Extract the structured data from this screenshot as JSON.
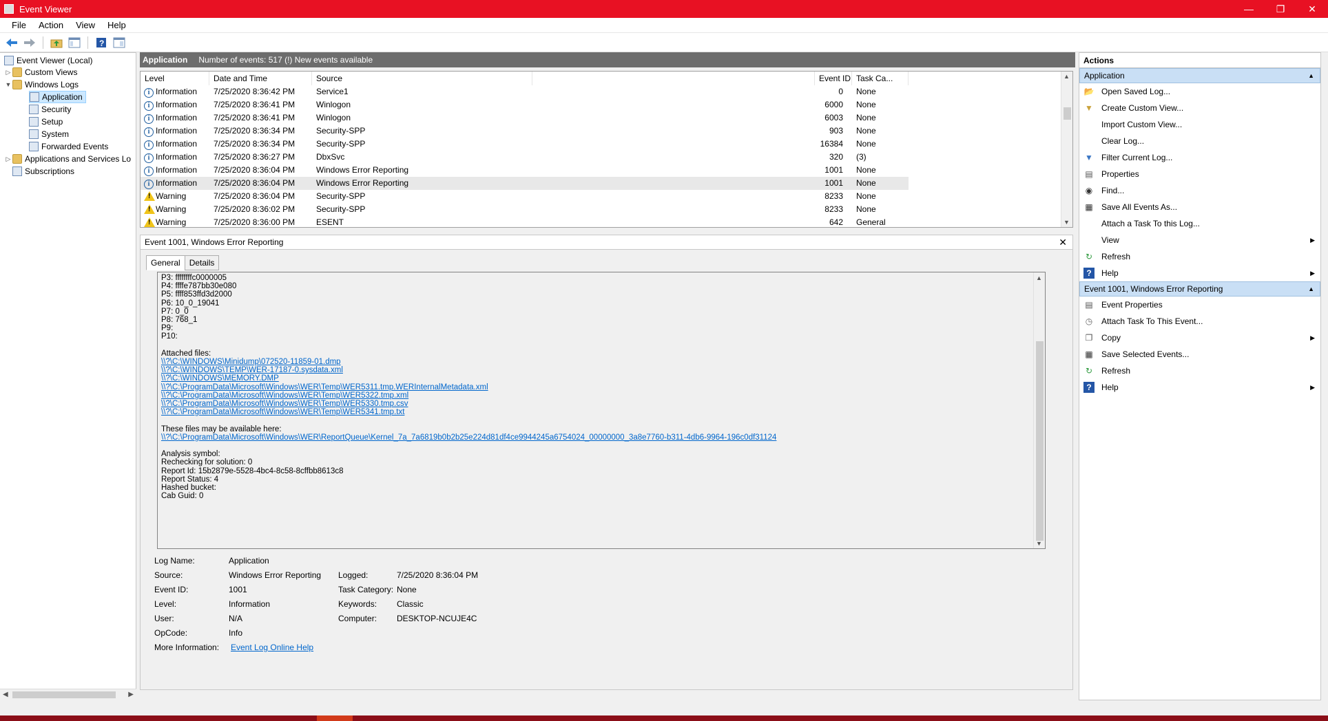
{
  "window": {
    "title": "Event Viewer"
  },
  "menu": [
    "File",
    "Action",
    "View",
    "Help"
  ],
  "tree": {
    "root": "Event Viewer (Local)",
    "custom_views": "Custom Views",
    "windows_logs": "Windows Logs",
    "logs": [
      "Application",
      "Security",
      "Setup",
      "System",
      "Forwarded Events"
    ],
    "apps_services": "Applications and Services Lo",
    "subscriptions": "Subscriptions"
  },
  "list": {
    "header_title": "Application",
    "header_info": "Number of events: 517 (!) New events available",
    "columns": {
      "level": "Level",
      "datetime": "Date and Time",
      "source": "Source",
      "event_id": "Event ID",
      "task": "Task Ca..."
    },
    "rows": [
      {
        "level": "Information",
        "datetime": "7/25/2020 8:36:42 PM",
        "source": "Service1",
        "event_id": "0",
        "task": "None"
      },
      {
        "level": "Information",
        "datetime": "7/25/2020 8:36:41 PM",
        "source": "Winlogon",
        "event_id": "6000",
        "task": "None"
      },
      {
        "level": "Information",
        "datetime": "7/25/2020 8:36:41 PM",
        "source": "Winlogon",
        "event_id": "6003",
        "task": "None"
      },
      {
        "level": "Information",
        "datetime": "7/25/2020 8:36:34 PM",
        "source": "Security-SPP",
        "event_id": "903",
        "task": "None"
      },
      {
        "level": "Information",
        "datetime": "7/25/2020 8:36:34 PM",
        "source": "Security-SPP",
        "event_id": "16384",
        "task": "None"
      },
      {
        "level": "Information",
        "datetime": "7/25/2020 8:36:27 PM",
        "source": "DbxSvc",
        "event_id": "320",
        "task": "(3)"
      },
      {
        "level": "Information",
        "datetime": "7/25/2020 8:36:04 PM",
        "source": "Windows Error Reporting",
        "event_id": "1001",
        "task": "None"
      },
      {
        "level": "Information",
        "datetime": "7/25/2020 8:36:04 PM",
        "source": "Windows Error Reporting",
        "event_id": "1001",
        "task": "None"
      },
      {
        "level": "Warning",
        "datetime": "7/25/2020 8:36:04 PM",
        "source": "Security-SPP",
        "event_id": "8233",
        "task": "None"
      },
      {
        "level": "Warning",
        "datetime": "7/25/2020 8:36:02 PM",
        "source": "Security-SPP",
        "event_id": "8233",
        "task": "None"
      },
      {
        "level": "Warning",
        "datetime": "7/25/2020 8:36:00 PM",
        "source": "ESENT",
        "event_id": "642",
        "task": "General"
      }
    ]
  },
  "detail": {
    "title": "Event 1001, Windows Error Reporting",
    "tabs": [
      "General",
      "Details"
    ],
    "desc_lines": [
      "P3: ffffffffc0000005",
      "P4: ffffe787bb30e080",
      "P5: ffff853ffd3d2000",
      "P6: 10_0_19041",
      "P7: 0_0",
      "P8: 768_1",
      "P9:",
      "P10:",
      "",
      "Attached files:"
    ],
    "attached_files": [
      "\\\\?\\C:\\WINDOWS\\Minidump\\072520-11859-01.dmp",
      "\\\\?\\C:\\WINDOWS\\TEMP\\WER-17187-0.sysdata.xml",
      "\\\\?\\C:\\WINDOWS\\MEMORY.DMP",
      "\\\\?\\C:\\ProgramData\\Microsoft\\Windows\\WER\\Temp\\WER5311.tmp.WERInternalMetadata.xml",
      "\\\\?\\C:\\ProgramData\\Microsoft\\Windows\\WER\\Temp\\WER5322.tmp.xml",
      "\\\\?\\C:\\ProgramData\\Microsoft\\Windows\\WER\\Temp\\WER5330.tmp.csv",
      "\\\\?\\C:\\ProgramData\\Microsoft\\Windows\\WER\\Temp\\WER5341.tmp.txt"
    ],
    "available_label": "These files may be available here:",
    "available_path": "\\\\?\\C:\\ProgramData\\Microsoft\\Windows\\WER\\ReportQueue\\Kernel_7a_7a6819b0b2b25e224d81df4ce9944245a6754024_00000000_3a8e7760-b311-4db6-9964-196c0df31124",
    "analysis_lines": [
      "Analysis symbol:",
      "Rechecking for solution: 0",
      "Report Id: 15b2879e-5528-4bc4-8c58-8cffbb8613c8",
      "Report Status: 4",
      "Hashed bucket:",
      "Cab Guid: 0"
    ],
    "fields": {
      "log_name_label": "Log Name:",
      "log_name": "Application",
      "source_label": "Source:",
      "source": "Windows Error Reporting",
      "logged_label": "Logged:",
      "logged": "7/25/2020 8:36:04 PM",
      "event_id_label": "Event ID:",
      "event_id": "1001",
      "task_category_label": "Task Category:",
      "task_category": "None",
      "level_label": "Level:",
      "level": "Information",
      "keywords_label": "Keywords:",
      "keywords": "Classic",
      "user_label": "User:",
      "user": "N/A",
      "computer_label": "Computer:",
      "computer": "DESKTOP-NCUJE4C",
      "opcode_label": "OpCode:",
      "opcode": "Info",
      "more_info_label": "More Information:",
      "more_info_link": "Event Log Online Help"
    }
  },
  "actions": {
    "title": "Actions",
    "section1": "Application",
    "items1": [
      {
        "icon": "open-folder-icon",
        "label": "Open Saved Log..."
      },
      {
        "icon": "filter-star-icon",
        "label": "Create Custom View..."
      },
      {
        "icon": "none",
        "label": "Import Custom View..."
      },
      {
        "icon": "none",
        "label": "Clear Log..."
      },
      {
        "icon": "filter-icon",
        "label": "Filter Current Log..."
      },
      {
        "icon": "properties-icon",
        "label": "Properties"
      },
      {
        "icon": "binoculars-icon",
        "label": "Find..."
      },
      {
        "icon": "save-icon",
        "label": "Save All Events As..."
      },
      {
        "icon": "none",
        "label": "Attach a Task To this Log..."
      },
      {
        "icon": "none",
        "label": "View"
      },
      {
        "icon": "refresh-icon",
        "label": "Refresh"
      },
      {
        "icon": "help-icon",
        "label": "Help"
      }
    ],
    "section2": "Event 1001, Windows Error Reporting",
    "items2": [
      {
        "icon": "event-properties-icon",
        "label": "Event Properties"
      },
      {
        "icon": "attach-task-icon",
        "label": "Attach Task To This Event..."
      },
      {
        "icon": "copy-icon",
        "label": "Copy"
      },
      {
        "icon": "save-icon",
        "label": "Save Selected Events..."
      },
      {
        "icon": "refresh-icon",
        "label": "Refresh"
      },
      {
        "icon": "help-icon",
        "label": "Help"
      }
    ]
  },
  "colors": {
    "titlebar": "#e81123",
    "section": "#c9dff5",
    "link": "#0066cc"
  }
}
